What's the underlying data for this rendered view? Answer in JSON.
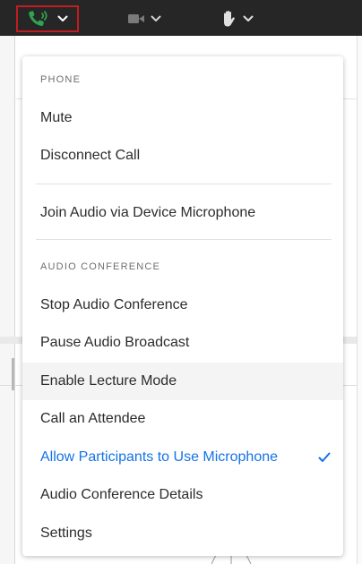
{
  "toolbar": {
    "phone_icon": "phone-audio-icon",
    "camera_icon": "camera-icon",
    "hand_icon": "raise-hand-icon",
    "chevron_icon": "chevron-down-icon",
    "active_outline_color": "#c11d22",
    "phone_color": "#2ea44f"
  },
  "menu": {
    "phone_section": {
      "header": "PHONE",
      "items": [
        "Mute",
        "Disconnect Call"
      ]
    },
    "device_item": "Join Audio via Device Microphone",
    "audio_section": {
      "header": "AUDIO CONFERENCE",
      "items": [
        "Stop Audio Conference",
        "Pause Audio Broadcast",
        "Enable Lecture Mode",
        "Call an Attendee",
        "Allow Participants to Use Microphone",
        "Audio Conference Details",
        "Settings"
      ],
      "hovered": "Enable Lecture Mode",
      "checked": "Allow Participants to Use Microphone"
    },
    "accent_color": "#1473e6",
    "check_icon": "checkmark-icon"
  }
}
